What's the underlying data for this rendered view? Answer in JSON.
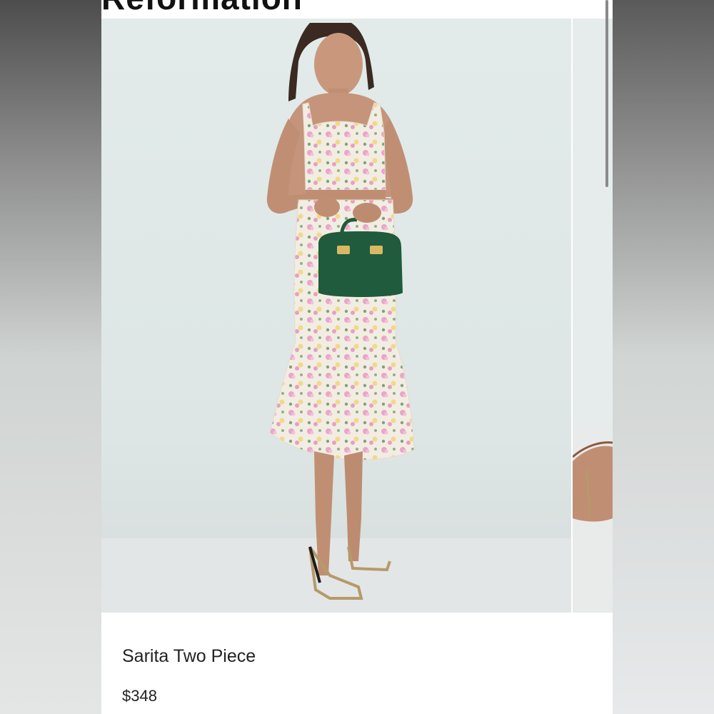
{
  "header": {
    "brand": "Reformation"
  },
  "product": {
    "name": "Sarita Two Piece",
    "price": "$348",
    "image_alt": "Model wearing floral two piece with green handbag"
  },
  "colors": {
    "background": "#ffffff",
    "text": "#222222",
    "bag": "#1f5b3c",
    "fabric": "#f1ece0"
  }
}
